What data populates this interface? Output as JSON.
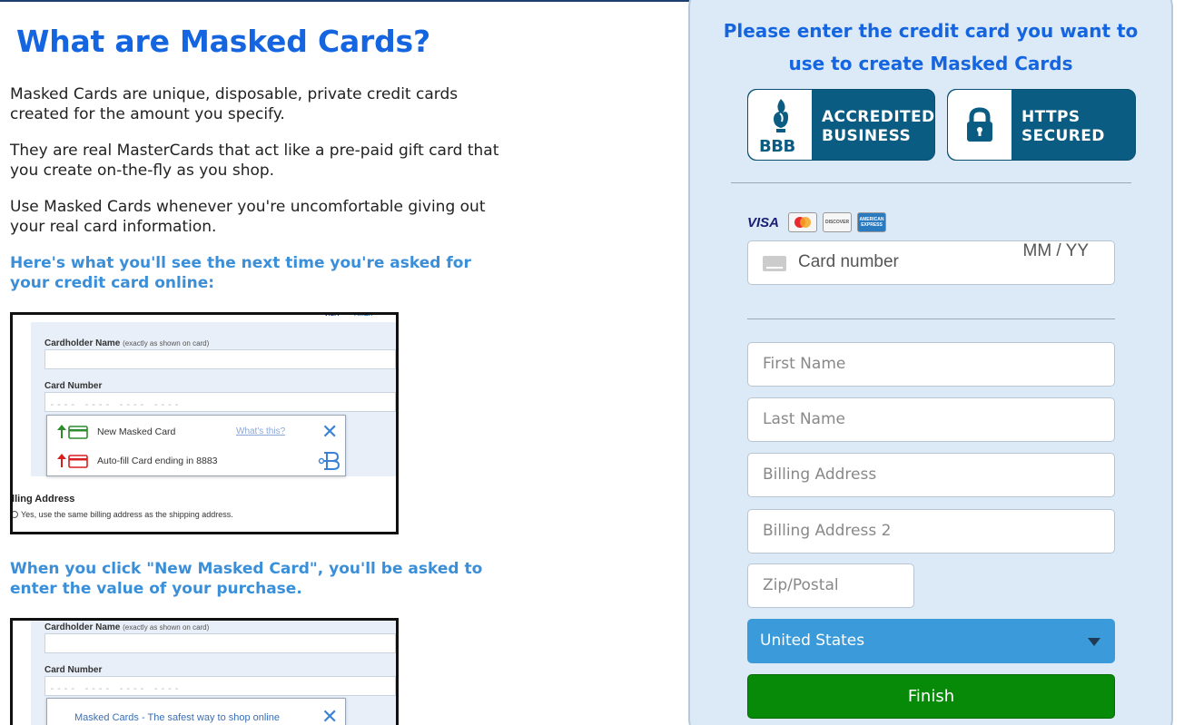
{
  "left": {
    "title": "What are Masked Cards?",
    "para1": "Masked Cards are unique, disposable, private credit cards created for the amount you specify.",
    "para2": "They are real MasterCards that act like a pre-paid gift card that you create on-the-fly as you shop.",
    "para3": "Use Masked Cards whenever you're uncomfortable giving out your real card information.",
    "subhead1": "Here's what you'll see the next time you're asked for your credit card online:",
    "subhead2": "When you click \"New Masked Card\", you'll be asked to enter the value of your purchase."
  },
  "screenshot1": {
    "cardholder_label": "Cardholder Name",
    "cardholder_hint": "(exactly as shown on card)",
    "card_number_label": "Card Number",
    "card_number_placeholder": "---- ---- ---- ----",
    "option_new": "New Masked Card",
    "whats_this": "What's this?",
    "option_autofill": "Auto-fill Card ending in 8883",
    "billing_label": "illing Address",
    "billing_sub": "Yes, use the same billing address as the shipping address."
  },
  "screenshot2": {
    "cardholder_label": "Cardholder Name",
    "cardholder_hint": "(exactly as shown on card)",
    "card_number_label": "Card Number",
    "card_number_placeholder": "---- ---- ---- ----",
    "popup_text": "Masked Cards - The safest way to shop online"
  },
  "panel": {
    "title": "Please enter the credit card you want to use to create Masked Cards",
    "badge_bbb_line1": "ACCREDITED",
    "badge_bbb_line2": "BUSINESS",
    "badge_bbb_logo": "BBB",
    "badge_https_line1": "HTTPS",
    "badge_https_line2": "SECURED",
    "card_brands": [
      "VISA",
      "MasterCard",
      "DISCOVER",
      "AMERICAN EXPRESS"
    ],
    "card_number_placeholder": "Card number",
    "expiry_placeholder": "MM / YY",
    "first_name_placeholder": "First Name",
    "last_name_placeholder": "Last Name",
    "billing_address_placeholder": "Billing Address",
    "billing_address2_placeholder": "Billing Address 2",
    "zip_placeholder": "Zip/Postal",
    "country_selected": "United States",
    "finish_label": "Finish"
  },
  "colors": {
    "title_blue": "#1565e0",
    "subhead_blue": "#3a8fd8",
    "panel_bg": "#dbeaf6",
    "badge_bg": "#0b5c82",
    "select_bg": "#3b9ad9",
    "finish_bg": "#078a07"
  }
}
